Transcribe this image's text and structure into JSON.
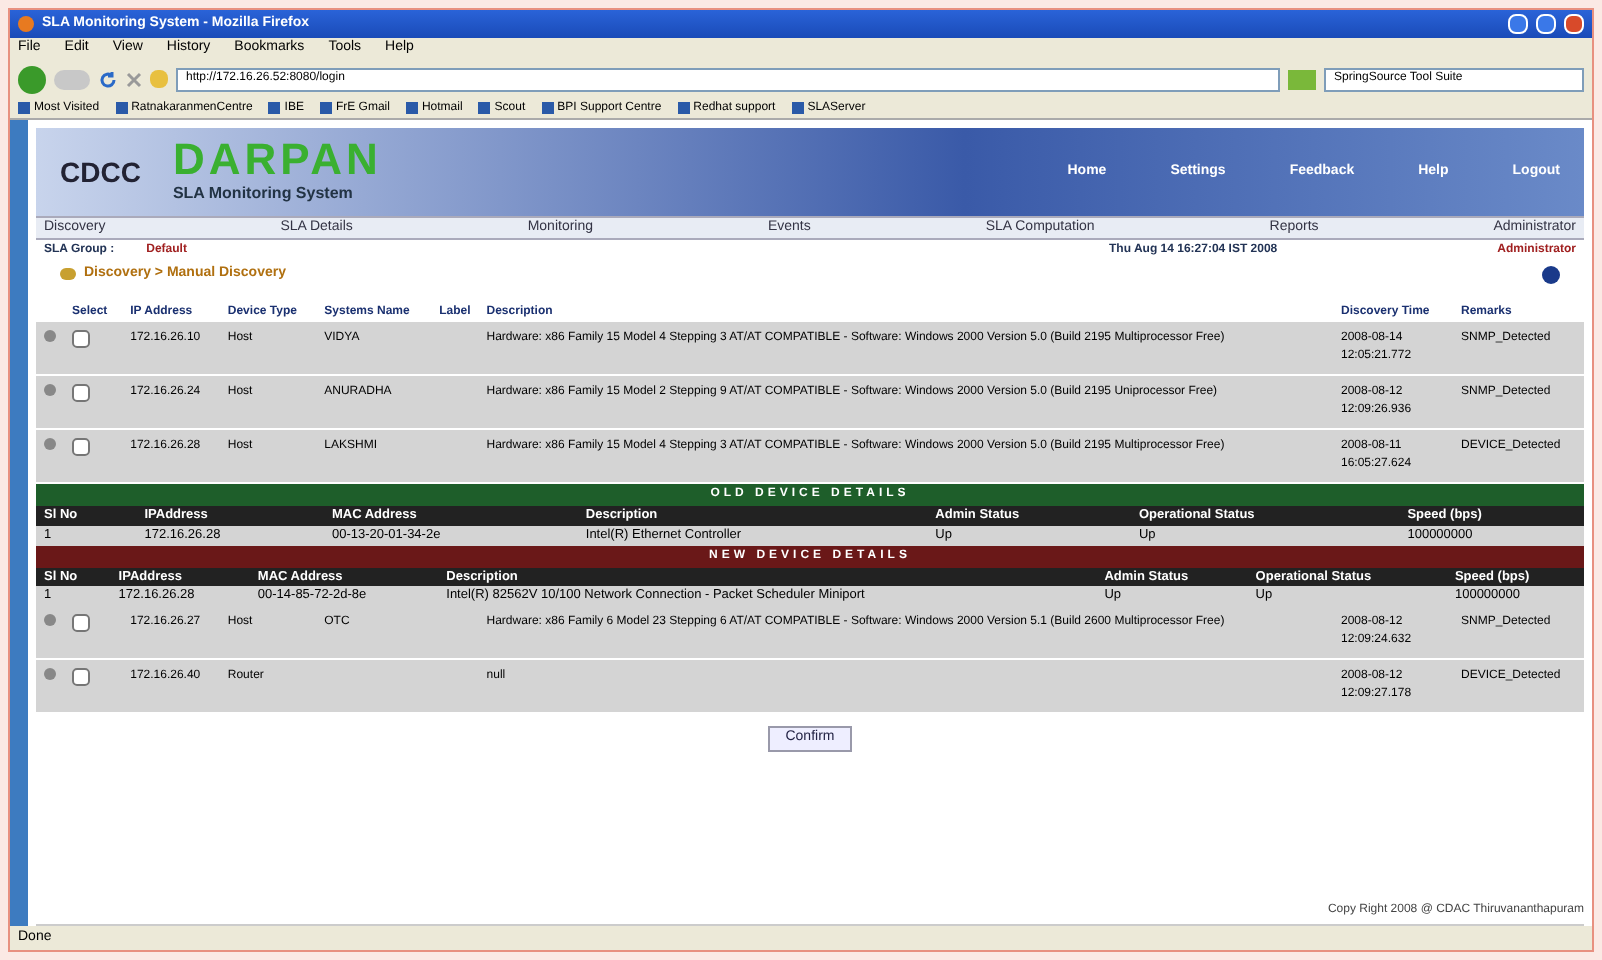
{
  "window": {
    "title": "SLA Monitoring System - Mozilla Firefox"
  },
  "menu_bar": [
    "File",
    "Edit",
    "View",
    "History",
    "Bookmarks",
    "Tools",
    "Help"
  ],
  "address_bar": {
    "value": "http://172.16.26.52:8080/login"
  },
  "search_field": {
    "value": "SpringSource Tool Suite"
  },
  "bookmarks": [
    "Most Visited",
    "RatnakaranmenCentre",
    "IBE",
    "FrE Gmail",
    "Hotmail",
    "Scout",
    "BPI Support Centre",
    "Redhat support",
    "SLAServer"
  ],
  "header": {
    "logo": "CDCC",
    "title": "DARPAN",
    "subtitle": "SLA Monitoring System",
    "links": [
      "Home",
      "Settings",
      "Feedback",
      "Help",
      "Logout"
    ]
  },
  "nav": [
    "Discovery",
    "SLA Details",
    "Monitoring",
    "Events",
    "SLA Computation",
    "Reports",
    "Administrator"
  ],
  "info_bar": {
    "group_label": "SLA Group :",
    "group": "Default",
    "date": "Thu Aug 14 16:27:04 IST 2008",
    "user": "Administrator"
  },
  "breadcrumb": "Discovery > Manual Discovery",
  "table": {
    "columns": [
      "Select",
      "IP Address",
      "Device Type",
      "Systems Name",
      "Label",
      "Description",
      "Discovery Time",
      "Remarks"
    ],
    "rows": [
      {
        "checked": false,
        "ip": "172.16.26.10",
        "type": "Host",
        "name": "VIDYA",
        "description": "Hardware: x86 Family 15 Model 4 Stepping 3 AT/AT COMPATIBLE - Software: Windows 2000 Version 5.0 (Build 2195 Multiprocessor Free)",
        "time": "2008-08-14 12:05:21.772",
        "remarks": "SNMP_Detected"
      },
      {
        "checked": false,
        "ip": "172.16.26.24",
        "type": "Host",
        "name": "ANURADHA",
        "description": "Hardware: x86 Family 15 Model 2 Stepping 9 AT/AT COMPATIBLE - Software: Windows 2000 Version 5.0 (Build 2195 Uniprocessor Free)",
        "time": "2008-08-12 12:09:26.936",
        "remarks": "SNMP_Detected"
      },
      {
        "checked": false,
        "ip": "172.16.26.28",
        "type": "Host",
        "name": "LAKSHMI",
        "description": "Hardware: x86 Family 15 Model 4 Stepping 3 AT/AT COMPATIBLE - Software: Windows 2000 Version 5.0 (Build 2195 Multiprocessor Free)",
        "time": "2008-08-11 16:05:27.624",
        "remarks": "DEVICE_Detected"
      }
    ]
  },
  "old_device": {
    "title": "OLD DEVICE DETAILS",
    "columns": [
      "Sl No",
      "IPAddress",
      "MAC Address",
      "Description",
      "Admin Status",
      "Operational Status",
      "Speed (bps)"
    ],
    "rows": [
      [
        "1",
        "172.16.26.28",
        "00-13-20-01-34-2e",
        "Intel(R) Ethernet Controller",
        "Up",
        "Up",
        "100000000"
      ]
    ]
  },
  "new_device": {
    "title": "NEW DEVICE DETAILS",
    "columns": [
      "Sl No",
      "IPAddress",
      "MAC Address",
      "Description",
      "Admin Status",
      "Operational Status",
      "Speed (bps)"
    ],
    "rows": [
      [
        "1",
        "172.16.26.28",
        "00-14-85-72-2d-8e",
        "Intel(R) 82562V 10/100 Network Connection - Packet Scheduler Miniport",
        "Up",
        "Up",
        "100000000"
      ]
    ]
  },
  "table2": {
    "rows": [
      {
        "checked": false,
        "ip": "172.16.26.27",
        "type": "Host",
        "name": "OTC",
        "description": "Hardware: x86 Family 6 Model 23 Stepping 6 AT/AT COMPATIBLE - Software: Windows 2000 Version 5.1 (Build 2600 Multiprocessor Free)",
        "time": "2008-08-12 12:09:24.632",
        "remarks": "SNMP_Detected"
      },
      {
        "checked": false,
        "ip": "172.16.26.40",
        "type": "Router",
        "name": "",
        "description": "null",
        "time": "2008-08-12 12:09:27.178",
        "remarks": "DEVICE_Detected"
      }
    ]
  },
  "confirm_button": "Confirm",
  "footer": "Copy Right 2008 @ CDAC Thiruvananthapuram",
  "status_bar": "Done"
}
